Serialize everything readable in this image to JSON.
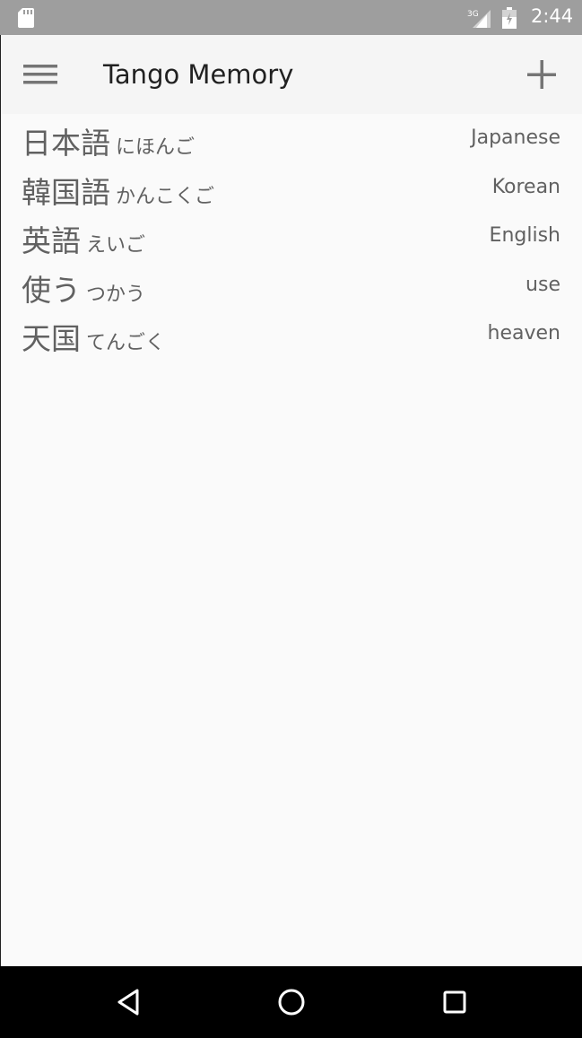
{
  "status_bar": {
    "network_label": "3G",
    "time": "2:44"
  },
  "app_bar": {
    "title": "Tango Memory",
    "menu_icon": "hamburger-menu-icon",
    "add_icon": "plus-icon"
  },
  "words": [
    {
      "kanji": "日本語",
      "reading": "にほんご",
      "meaning": "Japanese"
    },
    {
      "kanji": "韓国語",
      "reading": "かんこくご",
      "meaning": "Korean"
    },
    {
      "kanji": "英語",
      "reading": "えいご",
      "meaning": "English"
    },
    {
      "kanji": "使う",
      "reading": "つかう",
      "meaning": "use"
    },
    {
      "kanji": "天国",
      "reading": "てんごく",
      "meaning": "heaven"
    }
  ],
  "nav_bar": {
    "back_icon": "back-triangle-icon",
    "home_icon": "home-circle-icon",
    "recents_icon": "recents-square-icon"
  },
  "colors": {
    "status_bar": "#9e9e9e",
    "app_bar": "#f5f5f5",
    "background": "#fafafa",
    "text_primary": "#212121",
    "text_secondary": "#616161",
    "nav_bar": "#000000"
  }
}
